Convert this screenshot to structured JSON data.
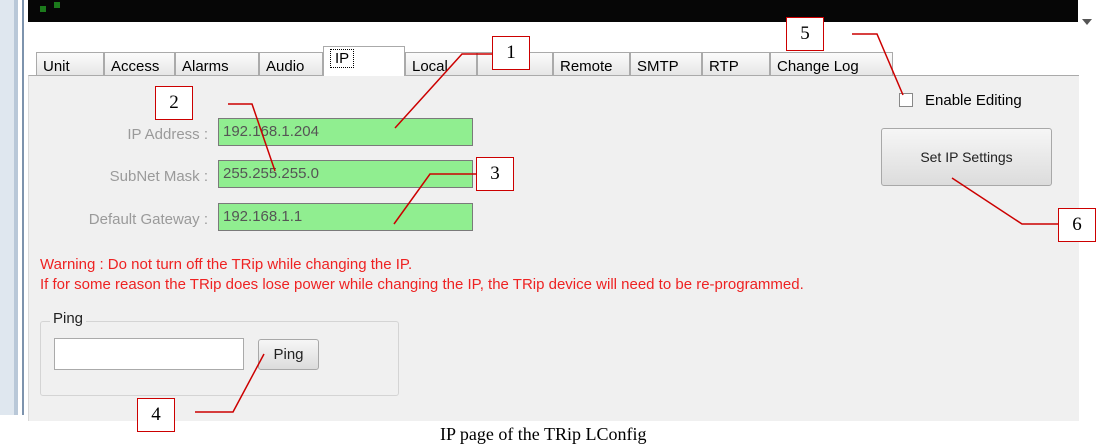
{
  "tabs": [
    {
      "label": "Unit"
    },
    {
      "label": "Access"
    },
    {
      "label": "Alarms"
    },
    {
      "label": "Audio"
    },
    {
      "label": "IP",
      "active": true
    },
    {
      "label": "Local"
    },
    {
      "label": "Remote"
    },
    {
      "label": "SMTP"
    },
    {
      "label": "RTP"
    },
    {
      "label": "Change Log"
    }
  ],
  "ip": {
    "address_label": "IP Address :",
    "address_value": "192.168.1.204",
    "subnet_label": "SubNet Mask :",
    "subnet_value": "255.255.255.0",
    "gateway_label": "Default Gateway :",
    "gateway_value": "192.168.1.1"
  },
  "warning": {
    "line1": "Warning : Do not turn off the TRip while changing the IP.",
    "line2": "If for some reason the TRip does lose power while changing the IP, the TRip device will need to be re-programmed."
  },
  "ping": {
    "group_label": "Ping",
    "input_value": "",
    "button_label": "Ping"
  },
  "enable_editing": {
    "label": "Enable Editing",
    "checked": false
  },
  "set_ip_button": "Set IP Settings",
  "callouts": [
    "1",
    "2",
    "3",
    "4",
    "5",
    "6"
  ],
  "caption": "IP page of the TRip LConfig",
  "colors": {
    "field_bg": "#90ee90",
    "warning": "#ee2222",
    "callout_line": "#cc0000"
  }
}
